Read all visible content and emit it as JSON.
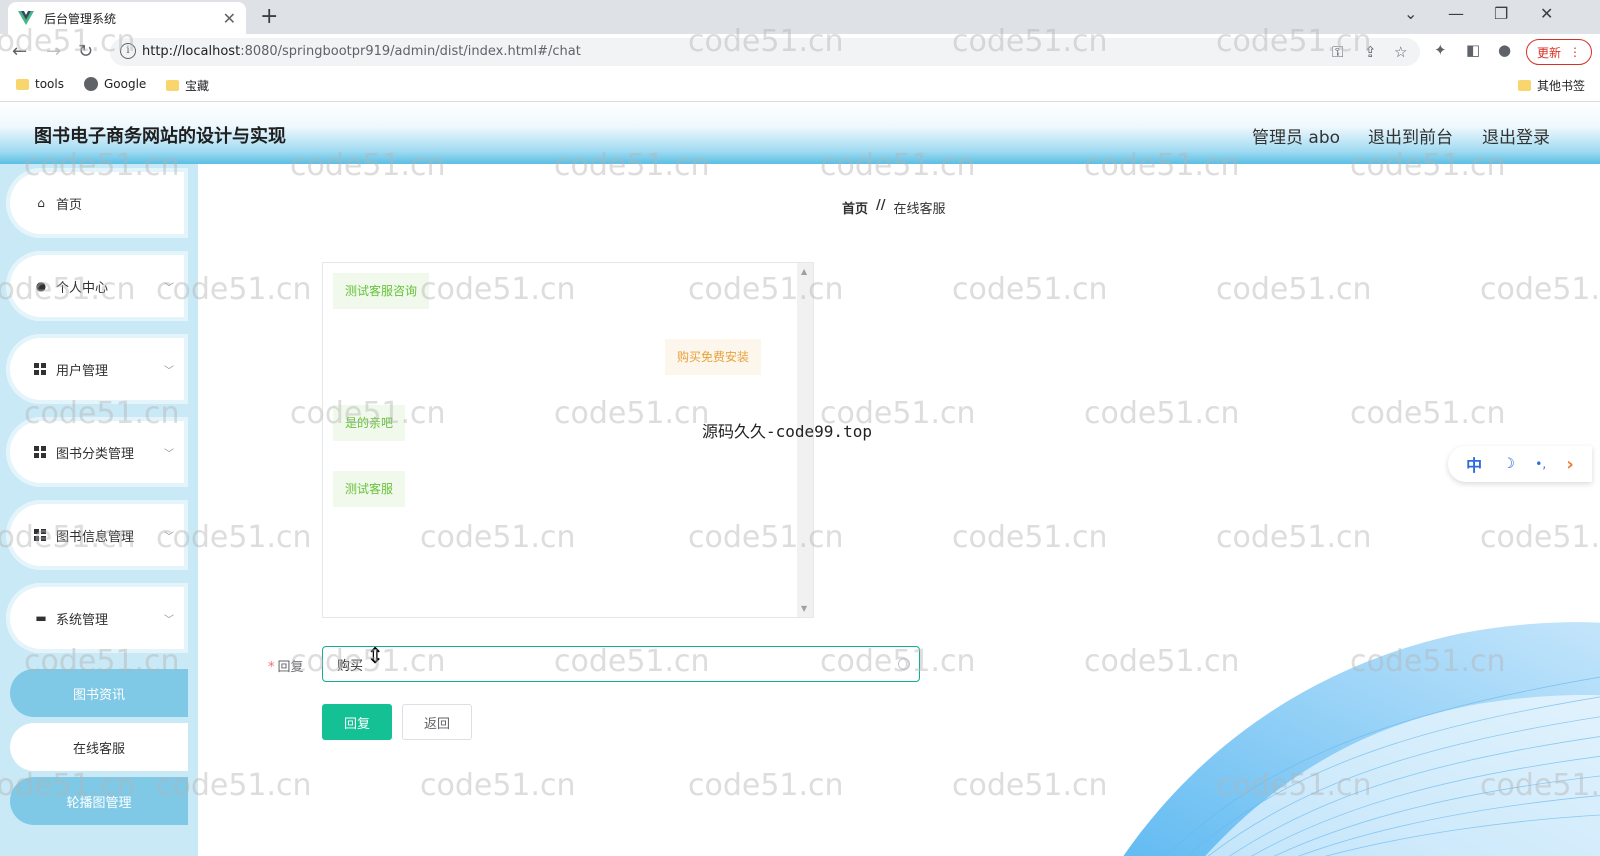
{
  "browser": {
    "tab_title": "后台管理系统",
    "url_host": "http://localhost",
    "url_rest": ":8080/springbootpr919/admin/dist/index.html#/chat",
    "update_label": "更新",
    "bookmarks": [
      "tools",
      "Google",
      "宝藏"
    ],
    "other_bookmarks": "其他书签"
  },
  "header": {
    "title": "图书电子商务网站的设计与实现",
    "admin_label": "管理员 abo",
    "exit_front": "退出到前台",
    "logout": "退出登录"
  },
  "sidebar": {
    "items": [
      {
        "label": "首页",
        "icon": "home-icon"
      },
      {
        "label": "个人中心",
        "icon": "user-icon"
      },
      {
        "label": "用户管理",
        "icon": "grid-icon"
      },
      {
        "label": "图书分类管理",
        "icon": "grid-icon"
      },
      {
        "label": "图书信息管理",
        "icon": "grid-icon"
      },
      {
        "label": "系统管理",
        "icon": "briefcase-icon"
      }
    ],
    "sub_items": [
      "图书资讯",
      "在线客服",
      "轮播图管理"
    ]
  },
  "breadcrumb": {
    "home": "首页",
    "separator": "//",
    "current": "在线客服"
  },
  "chat": {
    "messages": [
      {
        "side": "left",
        "text": "测试客服咨询"
      },
      {
        "side": "right",
        "text": "购买免费安装"
      },
      {
        "side": "left",
        "text": "是的亲吧"
      },
      {
        "side": "left",
        "text": "测试客服"
      }
    ],
    "overlay_text": "源码久久-code99.top"
  },
  "form": {
    "reply_label": "回复",
    "reply_value": "购买",
    "submit_label": "回复",
    "back_label": "返回"
  },
  "float_tool": {
    "lang": "中",
    "moon": "☽",
    "dots": "•,",
    "arrow": "›"
  },
  "watermark_text": "code51.cn",
  "colors": {
    "primary": "#13c195",
    "sidebar_bg": "#c8e9f5",
    "sub_active": "#7fc9e6"
  }
}
